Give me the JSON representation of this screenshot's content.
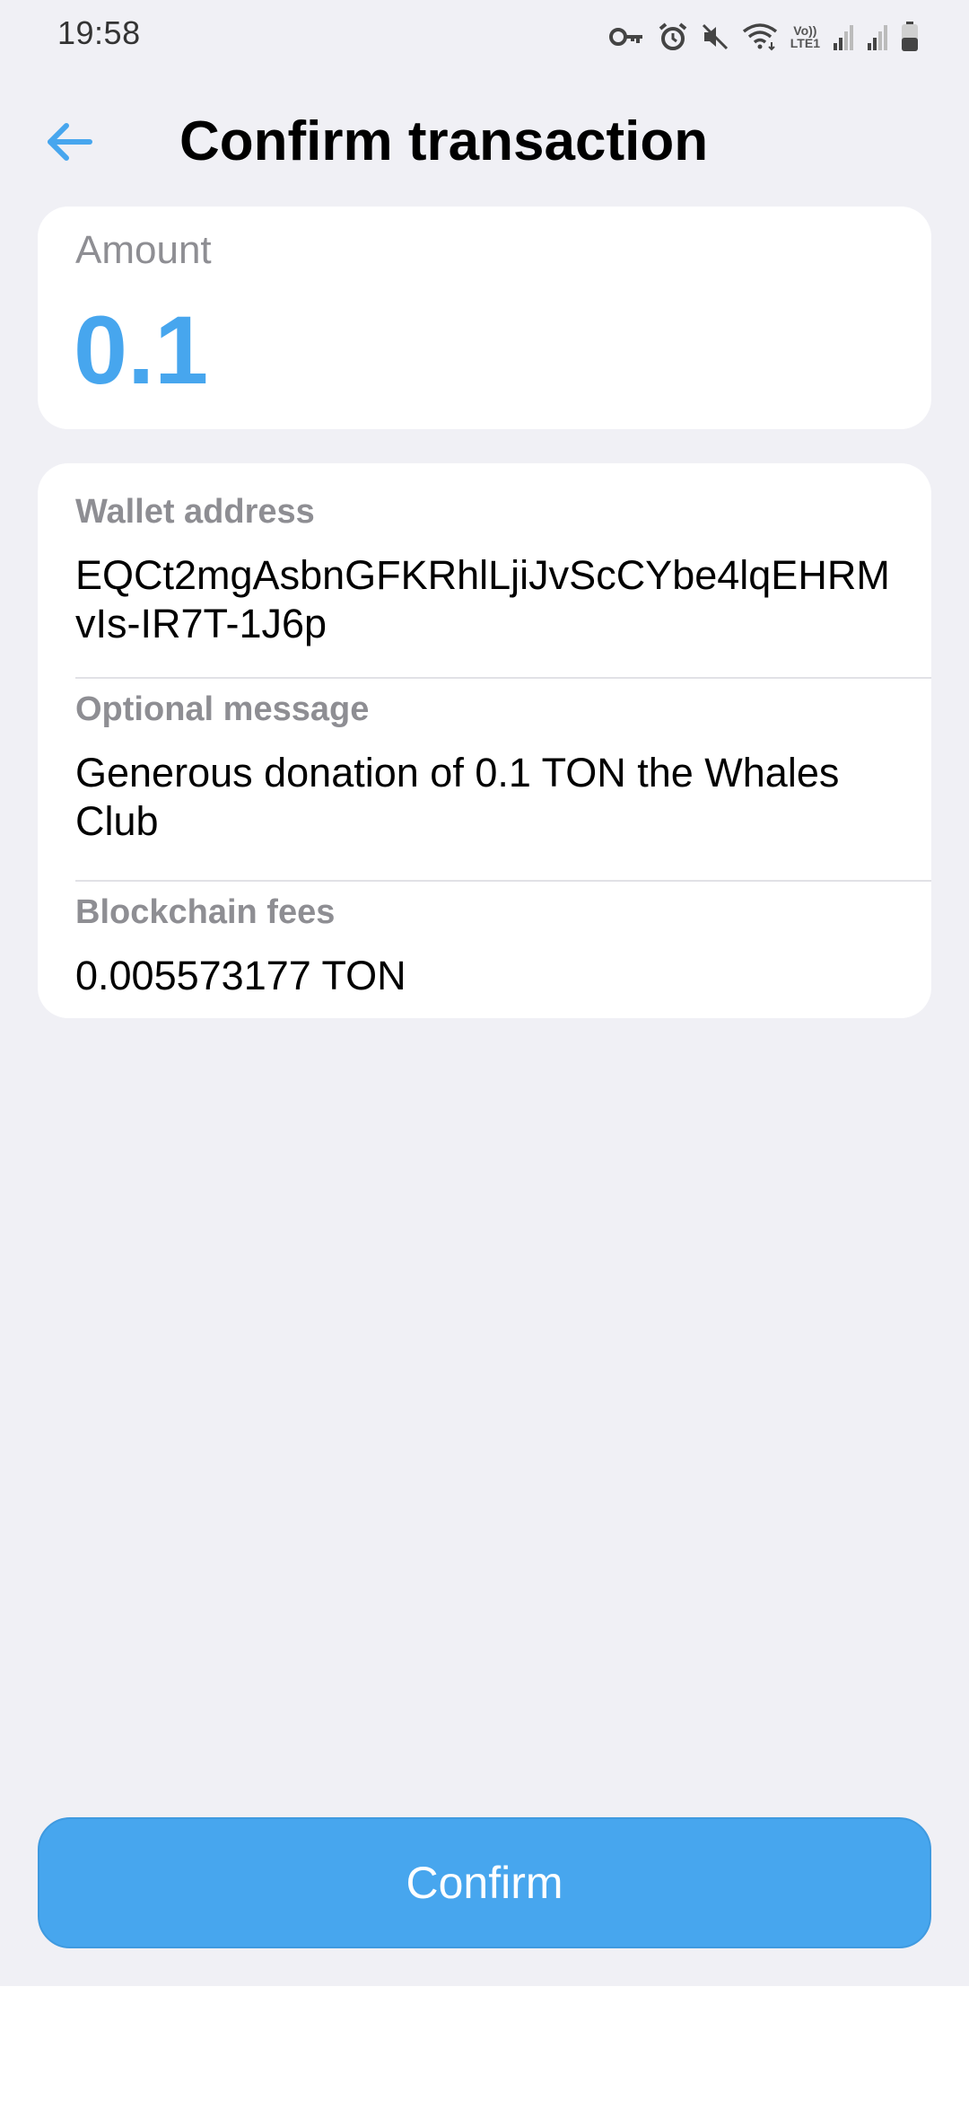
{
  "status_bar": {
    "time": "19:58",
    "icons": [
      "vpn-key-icon",
      "alarm-icon",
      "mute-icon",
      "wifi-icon",
      "volte-icon",
      "signal-icon",
      "signal-icon",
      "battery-icon"
    ],
    "volte_label": "Vo)) LTE1"
  },
  "header": {
    "back_icon": "arrow-left-icon",
    "title": "Confirm transaction"
  },
  "amount": {
    "label": "Amount",
    "value": "0.1"
  },
  "details": {
    "wallet_address": {
      "label": "Wallet address",
      "value": "EQCt2mgAsbnGFKRhlLjiJvScCYbe4lqEHRMvIs-IR7T-1J6p"
    },
    "optional_message": {
      "label": "Optional message",
      "value": "Generous donation of 0.1 TON the Whales Club"
    },
    "blockchain_fees": {
      "label": "Blockchain fees",
      "value": "0.005573177 TON"
    }
  },
  "confirm_button": {
    "label": "Confirm"
  },
  "colors": {
    "accent": "#47a6ee",
    "background": "#f0f0f5",
    "card": "#ffffff",
    "secondary_text": "#8e8e93"
  }
}
